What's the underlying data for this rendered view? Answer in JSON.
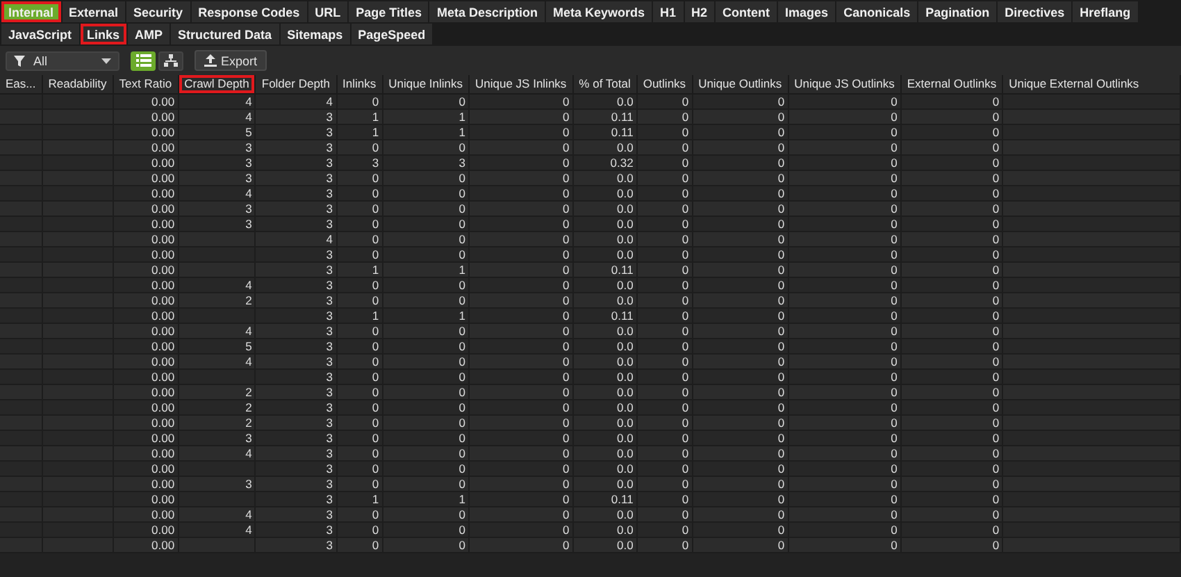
{
  "tabs": [
    {
      "label": "Internal",
      "selected": true,
      "highlighted": true
    },
    {
      "label": "External",
      "selected": false,
      "highlighted": false
    },
    {
      "label": "Security",
      "selected": false,
      "highlighted": false
    },
    {
      "label": "Response Codes",
      "selected": false,
      "highlighted": false
    },
    {
      "label": "URL",
      "selected": false,
      "highlighted": false
    },
    {
      "label": "Page Titles",
      "selected": false,
      "highlighted": false
    },
    {
      "label": "Meta Description",
      "selected": false,
      "highlighted": false
    },
    {
      "label": "Meta Keywords",
      "selected": false,
      "highlighted": false
    },
    {
      "label": "H1",
      "selected": false,
      "highlighted": false
    },
    {
      "label": "H2",
      "selected": false,
      "highlighted": false
    },
    {
      "label": "Content",
      "selected": false,
      "highlighted": false
    },
    {
      "label": "Images",
      "selected": false,
      "highlighted": false
    },
    {
      "label": "Canonicals",
      "selected": false,
      "highlighted": false
    },
    {
      "label": "Pagination",
      "selected": false,
      "highlighted": false
    },
    {
      "label": "Directives",
      "selected": false,
      "highlighted": false
    },
    {
      "label": "Hreflang",
      "selected": false,
      "highlighted": false
    },
    {
      "label": "JavaScript",
      "selected": false,
      "highlighted": false
    },
    {
      "label": "Links",
      "selected": false,
      "highlighted": true
    },
    {
      "label": "AMP",
      "selected": false,
      "highlighted": false
    },
    {
      "label": "Structured Data",
      "selected": false,
      "highlighted": false
    },
    {
      "label": "Sitemaps",
      "selected": false,
      "highlighted": false
    },
    {
      "label": "PageSpeed",
      "selected": false,
      "highlighted": false
    }
  ],
  "toolbar": {
    "filter": {
      "value": "All"
    },
    "views": [
      {
        "kind": "list",
        "selected": true
      },
      {
        "kind": "tree",
        "selected": false
      }
    ],
    "export_button": {
      "label": "Export"
    }
  },
  "table": {
    "columns": [
      {
        "label": "Eas...",
        "highlighted": false
      },
      {
        "label": "Readability",
        "highlighted": false
      },
      {
        "label": "Text Ratio",
        "highlighted": false
      },
      {
        "label": "Crawl Depth",
        "highlighted": true
      },
      {
        "label": "Folder Depth",
        "highlighted": false
      },
      {
        "label": "Inlinks",
        "highlighted": false
      },
      {
        "label": "Unique Inlinks",
        "highlighted": false
      },
      {
        "label": "Unique JS Inlinks",
        "highlighted": false
      },
      {
        "label": "% of Total",
        "highlighted": false
      },
      {
        "label": "Outlinks",
        "highlighted": false
      },
      {
        "label": "Unique Outlinks",
        "highlighted": false
      },
      {
        "label": "Unique JS Outlinks",
        "highlighted": false
      },
      {
        "label": "External Outlinks",
        "highlighted": false
      },
      {
        "label": "Unique External Outlinks",
        "highlighted": false
      }
    ],
    "rows": [
      [
        null,
        null,
        "0.00",
        "4",
        "4",
        "0",
        "0",
        "0",
        "0.0",
        "0",
        "0",
        "0",
        "0",
        null
      ],
      [
        null,
        null,
        "0.00",
        "4",
        "3",
        "1",
        "1",
        "0",
        "0.11",
        "0",
        "0",
        "0",
        "0",
        null
      ],
      [
        null,
        null,
        "0.00",
        "5",
        "3",
        "1",
        "1",
        "0",
        "0.11",
        "0",
        "0",
        "0",
        "0",
        null
      ],
      [
        null,
        null,
        "0.00",
        "3",
        "3",
        "0",
        "0",
        "0",
        "0.0",
        "0",
        "0",
        "0",
        "0",
        null
      ],
      [
        null,
        null,
        "0.00",
        "3",
        "3",
        "3",
        "3",
        "0",
        "0.32",
        "0",
        "0",
        "0",
        "0",
        null
      ],
      [
        null,
        null,
        "0.00",
        "3",
        "3",
        "0",
        "0",
        "0",
        "0.0",
        "0",
        "0",
        "0",
        "0",
        null
      ],
      [
        null,
        null,
        "0.00",
        "4",
        "3",
        "0",
        "0",
        "0",
        "0.0",
        "0",
        "0",
        "0",
        "0",
        null
      ],
      [
        null,
        null,
        "0.00",
        "3",
        "3",
        "0",
        "0",
        "0",
        "0.0",
        "0",
        "0",
        "0",
        "0",
        null
      ],
      [
        null,
        null,
        "0.00",
        "3",
        "3",
        "0",
        "0",
        "0",
        "0.0",
        "0",
        "0",
        "0",
        "0",
        null
      ],
      [
        null,
        null,
        "0.00",
        null,
        "4",
        "0",
        "0",
        "0",
        "0.0",
        "0",
        "0",
        "0",
        "0",
        null
      ],
      [
        null,
        null,
        "0.00",
        null,
        "3",
        "0",
        "0",
        "0",
        "0.0",
        "0",
        "0",
        "0",
        "0",
        null
      ],
      [
        null,
        null,
        "0.00",
        null,
        "3",
        "1",
        "1",
        "0",
        "0.11",
        "0",
        "0",
        "0",
        "0",
        null
      ],
      [
        null,
        null,
        "0.00",
        "4",
        "3",
        "0",
        "0",
        "0",
        "0.0",
        "0",
        "0",
        "0",
        "0",
        null
      ],
      [
        null,
        null,
        "0.00",
        "2",
        "3",
        "0",
        "0",
        "0",
        "0.0",
        "0",
        "0",
        "0",
        "0",
        null
      ],
      [
        null,
        null,
        "0.00",
        null,
        "3",
        "1",
        "1",
        "0",
        "0.11",
        "0",
        "0",
        "0",
        "0",
        null
      ],
      [
        null,
        null,
        "0.00",
        "4",
        "3",
        "0",
        "0",
        "0",
        "0.0",
        "0",
        "0",
        "0",
        "0",
        null
      ],
      [
        null,
        null,
        "0.00",
        "5",
        "3",
        "0",
        "0",
        "0",
        "0.0",
        "0",
        "0",
        "0",
        "0",
        null
      ],
      [
        null,
        null,
        "0.00",
        "4",
        "3",
        "0",
        "0",
        "0",
        "0.0",
        "0",
        "0",
        "0",
        "0",
        null
      ],
      [
        null,
        null,
        "0.00",
        null,
        "3",
        "0",
        "0",
        "0",
        "0.0",
        "0",
        "0",
        "0",
        "0",
        null
      ],
      [
        null,
        null,
        "0.00",
        "2",
        "3",
        "0",
        "0",
        "0",
        "0.0",
        "0",
        "0",
        "0",
        "0",
        null
      ],
      [
        null,
        null,
        "0.00",
        "2",
        "3",
        "0",
        "0",
        "0",
        "0.0",
        "0",
        "0",
        "0",
        "0",
        null
      ],
      [
        null,
        null,
        "0.00",
        "2",
        "3",
        "0",
        "0",
        "0",
        "0.0",
        "0",
        "0",
        "0",
        "0",
        null
      ],
      [
        null,
        null,
        "0.00",
        "3",
        "3",
        "0",
        "0",
        "0",
        "0.0",
        "0",
        "0",
        "0",
        "0",
        null
      ],
      [
        null,
        null,
        "0.00",
        "4",
        "3",
        "0",
        "0",
        "0",
        "0.0",
        "0",
        "0",
        "0",
        "0",
        null
      ],
      [
        null,
        null,
        "0.00",
        null,
        "3",
        "0",
        "0",
        "0",
        "0.0",
        "0",
        "0",
        "0",
        "0",
        null
      ],
      [
        null,
        null,
        "0.00",
        "3",
        "3",
        "0",
        "0",
        "0",
        "0.0",
        "0",
        "0",
        "0",
        "0",
        null
      ],
      [
        null,
        null,
        "0.00",
        null,
        "3",
        "1",
        "1",
        "0",
        "0.11",
        "0",
        "0",
        "0",
        "0",
        null
      ],
      [
        null,
        null,
        "0.00",
        "4",
        "3",
        "0",
        "0",
        "0",
        "0.0",
        "0",
        "0",
        "0",
        "0",
        null
      ],
      [
        null,
        null,
        "0.00",
        "4",
        "3",
        "0",
        "0",
        "0",
        "0.0",
        "0",
        "0",
        "0",
        "0",
        null
      ],
      [
        null,
        null,
        "0.00",
        null,
        "3",
        "0",
        "0",
        "0",
        "0.0",
        "0",
        "0",
        "0",
        "0",
        null
      ]
    ]
  }
}
